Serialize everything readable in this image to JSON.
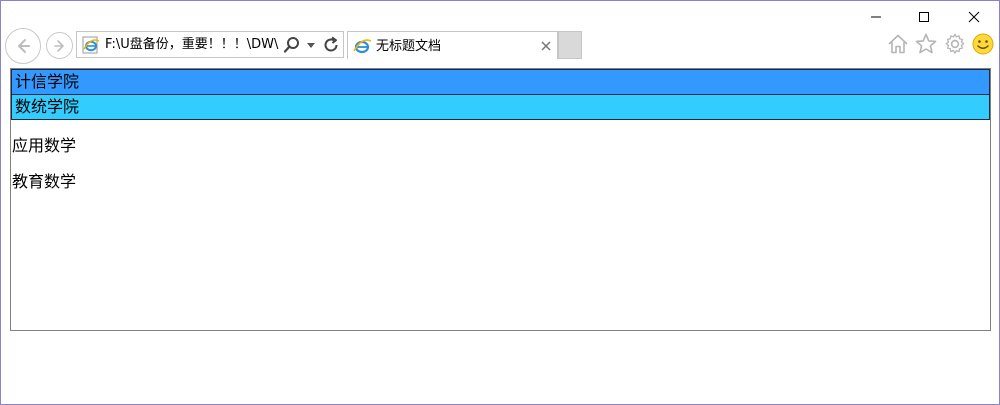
{
  "window": {
    "controls": {
      "minimize_icon": "minimize-icon",
      "maximize_icon": "maximize-icon",
      "close_icon": "close-icon"
    }
  },
  "browser": {
    "address_value": "F:\\U盘备份，重要！！！\\DW\\",
    "tab_title": "无标题文档",
    "colors": {
      "chrome_border": "#c6c6c6",
      "new_tab_bg": "#d9d9d9",
      "window_border": "#8a84c6"
    }
  },
  "page": {
    "menu": [
      {
        "label": "计信学院",
        "color": "#3399ff",
        "children": []
      },
      {
        "label": "数统学院",
        "color": "#33ccff",
        "children": [
          {
            "label": "应用数学"
          },
          {
            "label": "教育数学"
          }
        ]
      }
    ]
  }
}
